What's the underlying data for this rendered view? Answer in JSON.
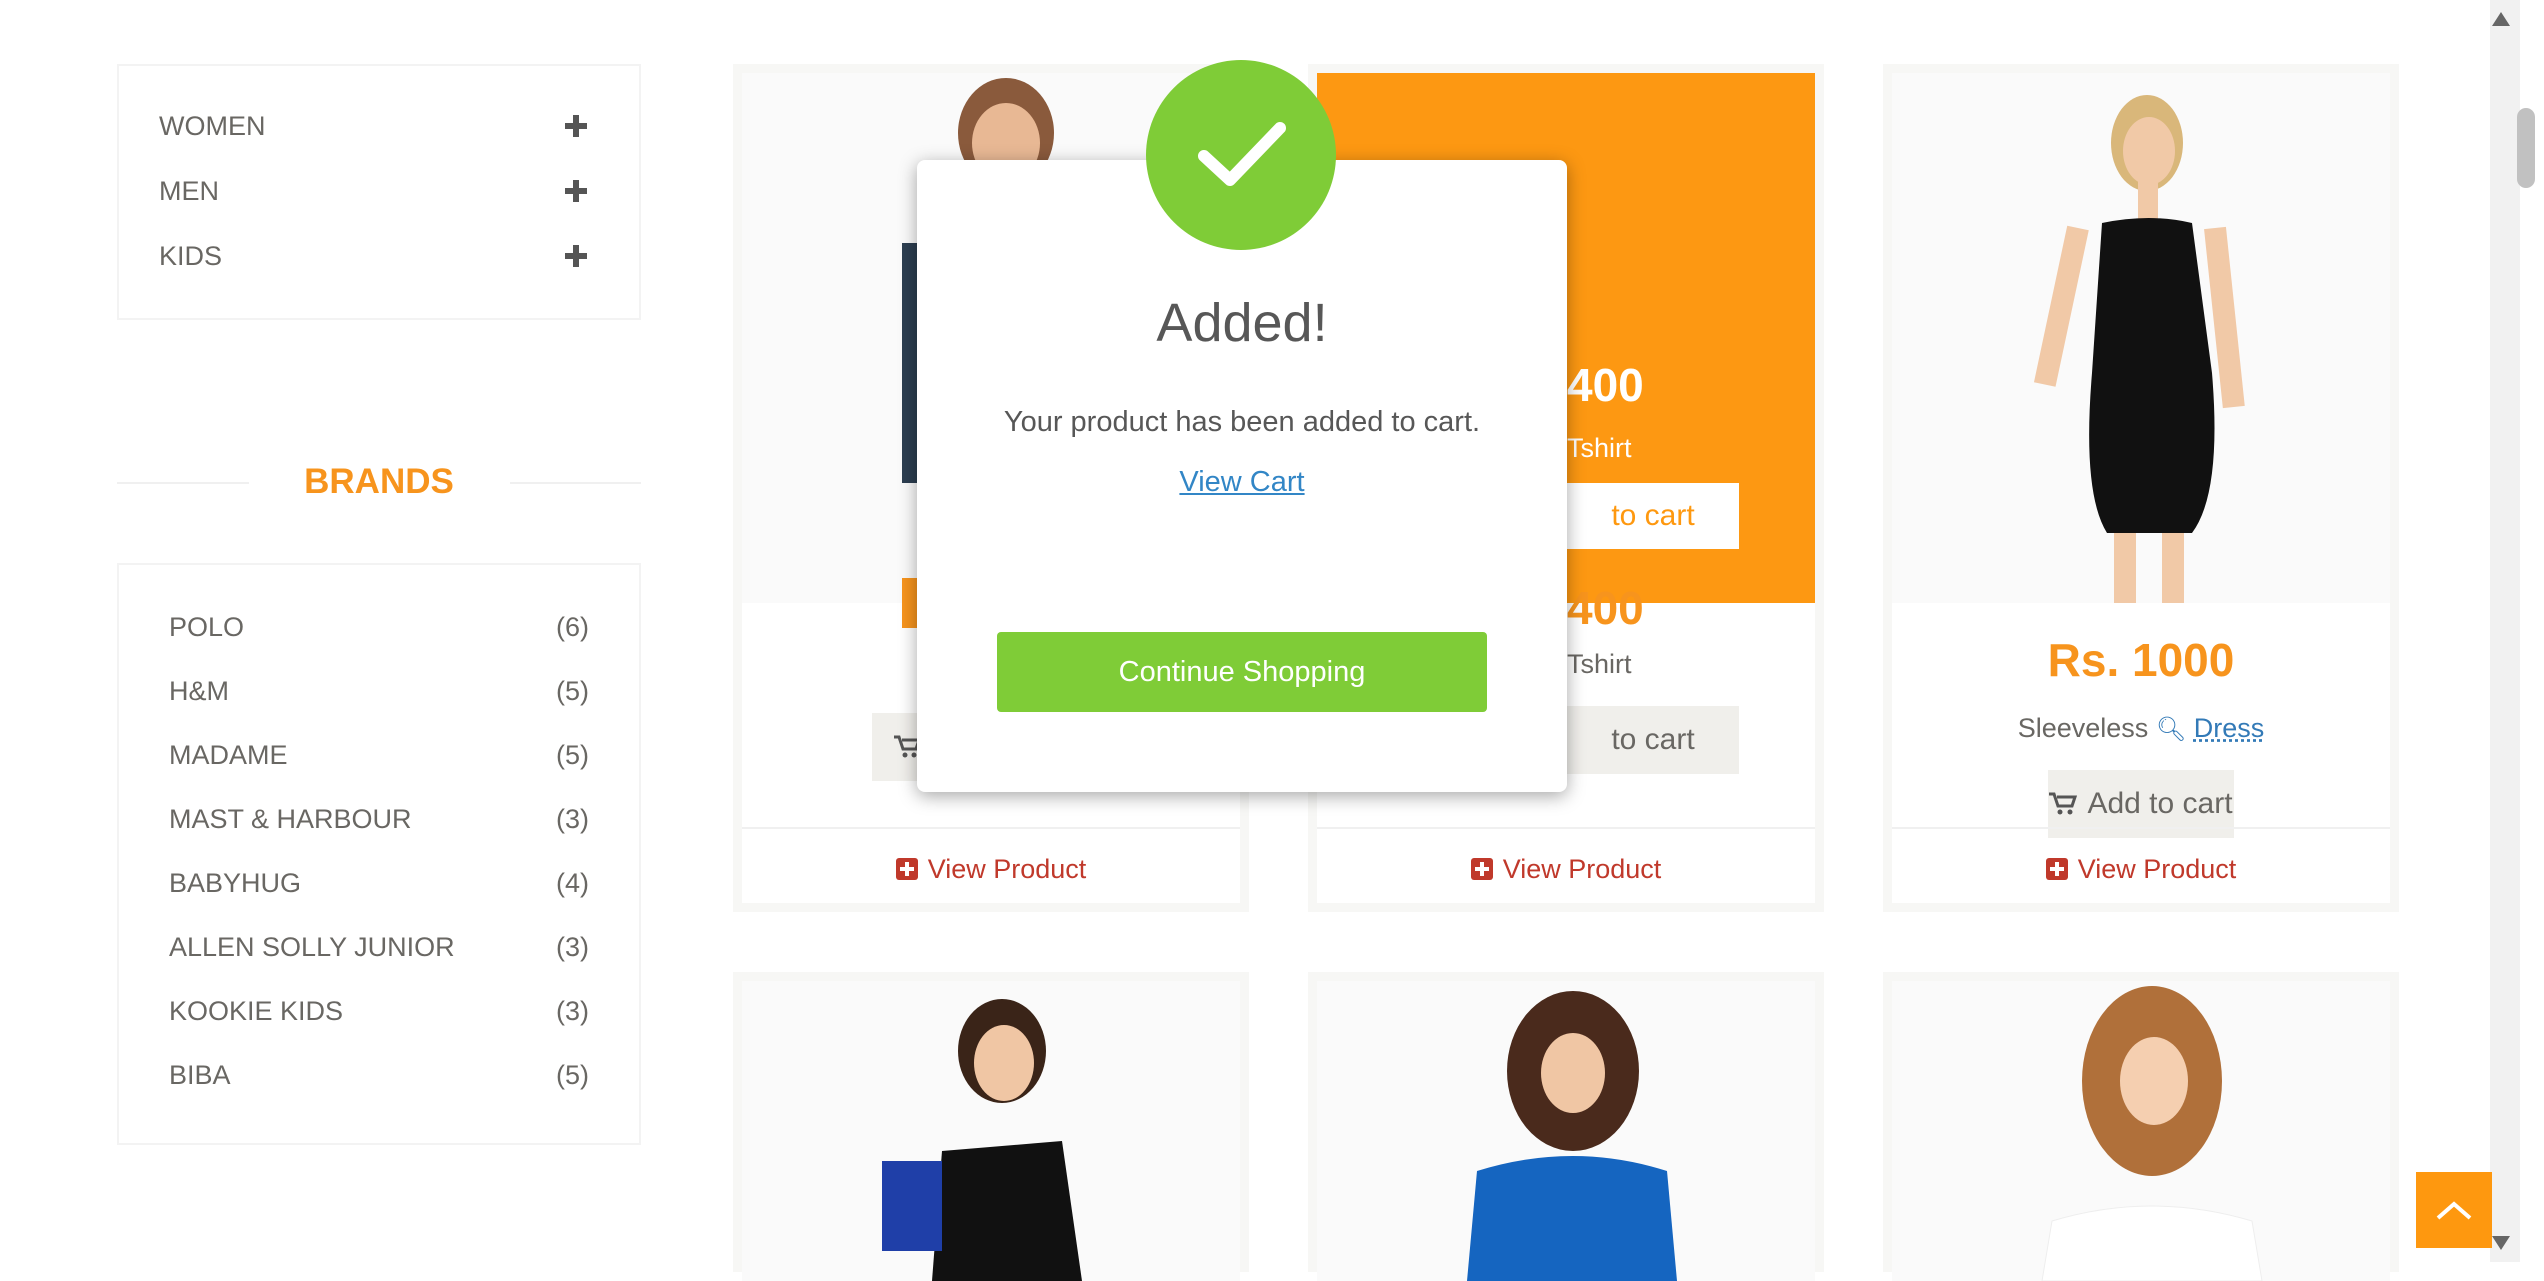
{
  "sidebar": {
    "categories": [
      {
        "label": "WOMEN"
      },
      {
        "label": "MEN"
      },
      {
        "label": "KIDS"
      }
    ],
    "brands_title": "BRANDS",
    "brands": [
      {
        "name": "POLO",
        "count": "(6)"
      },
      {
        "name": "H&M",
        "count": "(5)"
      },
      {
        "name": "MADAME",
        "count": "(5)"
      },
      {
        "name": "MAST & HARBOUR",
        "count": "(3)"
      },
      {
        "name": "BABYHUG",
        "count": "(4)"
      },
      {
        "name": "ALLEN SOLLY JUNIOR",
        "count": "(3)"
      },
      {
        "name": "KOOKIE KIDS",
        "count": "(3)"
      },
      {
        "name": "BIBA",
        "count": "(5)"
      }
    ]
  },
  "products": [
    {
      "price": "Rs. 1000",
      "name": "Sleeveless",
      "link": "Dress",
      "add_label": "Add to cart",
      "view_label": "View Product"
    },
    {
      "price_overlay": "400",
      "name_overlay": "Tshirt",
      "overlay_add": "to cart",
      "price": "400",
      "name": "Tshirt",
      "add_label": "to cart",
      "view_label": "View Product"
    },
    {
      "view_label": "View Product"
    }
  ],
  "modal": {
    "title": "Added!",
    "message": "Your product has been added to cart.",
    "view_cart": "View Cart",
    "continue": "Continue Shopping"
  },
  "colors": {
    "accent": "#f7941d",
    "success": "#7fcc37",
    "link": "#3286c6",
    "view_product": "#c0392b"
  }
}
